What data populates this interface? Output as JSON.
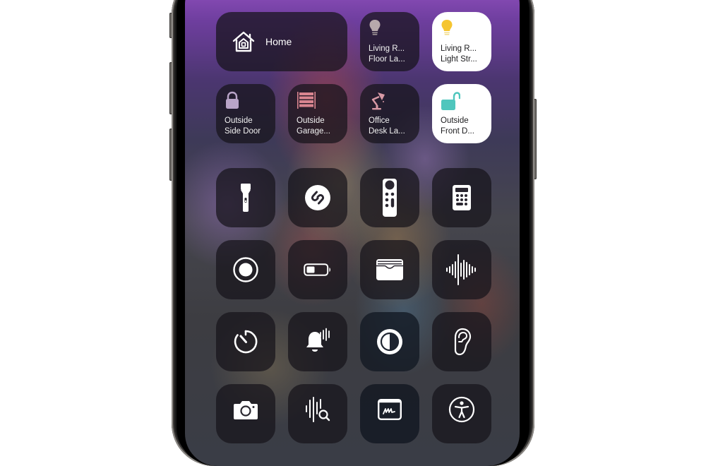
{
  "device": {
    "type": "iPhone",
    "screen": "Control Center"
  },
  "home_section": {
    "home_button": {
      "label": "Home",
      "icon": "home-icon"
    },
    "accessories": [
      {
        "id": "living-room-floor-lamp",
        "line1": "Living R...",
        "line2": "Floor La...",
        "icon": "lightbulb-icon",
        "state": "off",
        "icon_color": "#b7a9ac"
      },
      {
        "id": "living-room-light-strip",
        "line1": "Living R...",
        "line2": "Light Str...",
        "icon": "lightbulb-icon",
        "state": "on",
        "icon_color": "#f5c531"
      },
      {
        "id": "outside-side-door",
        "line1": "Outside",
        "line2": "Side Door",
        "icon": "lock-icon",
        "state": "locked",
        "icon_color": "#b9a4c8"
      },
      {
        "id": "outside-garage",
        "line1": "Outside",
        "line2": "Garage...",
        "icon": "garage-door-icon",
        "state": "closed",
        "icon_color": "#d98590"
      },
      {
        "id": "office-desk-lamp",
        "line1": "Office",
        "line2": "Desk La...",
        "icon": "desk-lamp-icon",
        "state": "off",
        "icon_color": "#d99aa6"
      },
      {
        "id": "outside-front-door",
        "line1": "Outside",
        "line2": "Front D...",
        "icon": "unlock-icon",
        "state": "unlocked",
        "icon_color": "#4fc6bd"
      }
    ]
  },
  "controls": [
    {
      "id": "flashlight",
      "icon": "flashlight-icon"
    },
    {
      "id": "shazam",
      "icon": "shazam-icon"
    },
    {
      "id": "apple-tv-remote",
      "icon": "remote-icon"
    },
    {
      "id": "calculator",
      "icon": "calculator-icon"
    },
    {
      "id": "screen-recording",
      "icon": "screen-record-icon"
    },
    {
      "id": "low-power-mode",
      "icon": "battery-icon"
    },
    {
      "id": "wallet",
      "icon": "wallet-icon"
    },
    {
      "id": "voice-memos",
      "icon": "waveform-icon"
    },
    {
      "id": "timer",
      "icon": "timer-icon"
    },
    {
      "id": "sound-recognition",
      "icon": "sound-recognition-bell-icon"
    },
    {
      "id": "dark-mode",
      "icon": "dark-mode-icon"
    },
    {
      "id": "hearing",
      "icon": "ear-icon"
    },
    {
      "id": "camera",
      "icon": "camera-icon"
    },
    {
      "id": "music-recognition-search",
      "icon": "waveform-search-icon"
    },
    {
      "id": "quick-note",
      "icon": "quick-note-icon"
    },
    {
      "id": "accessibility-shortcuts",
      "icon": "accessibility-icon"
    }
  ]
}
